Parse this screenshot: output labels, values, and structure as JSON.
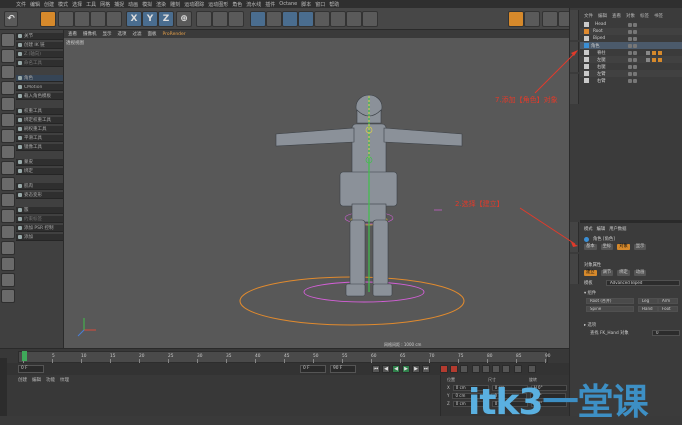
{
  "menubar": [
    "文件",
    "编辑",
    "创建",
    "模式",
    "选择",
    "工具",
    "网格",
    "捕捉",
    "动画",
    "模拟",
    "渲染",
    "雕刻",
    "运动跟踪",
    "运动图形",
    "角色",
    "流水线",
    "插件",
    "Octane",
    "脚本",
    "窗口",
    "帮助"
  ],
  "toolbar": {
    "undo_label": "↶",
    "axis_x": "X",
    "axis_y": "Y",
    "axis_z": "Z",
    "coord_label": "⊕"
  },
  "left_menu": [
    {
      "label": "关节",
      "dim": false,
      "hl": false
    },
    {
      "label": "创建 IK 链",
      "dim": false,
      "hl": false
    },
    {
      "label": "Z.(轴向)",
      "dim": true,
      "hl": false
    },
    {
      "label": "命名工具",
      "dim": true,
      "hl": false
    },
    {
      "label": "角色",
      "dim": false,
      "hl": true
    },
    {
      "label": "CMotion",
      "dim": false,
      "hl": false
    },
    {
      "label": "载入角色模板",
      "dim": false,
      "hl": false
    },
    {
      "label": "权重工具",
      "dim": false,
      "hl": false
    },
    {
      "label": "绑定权重工具",
      "dim": false,
      "hl": false
    },
    {
      "label": "刷权重工具",
      "dim": false,
      "hl": false
    },
    {
      "label": "平滑工具",
      "dim": false,
      "hl": false
    },
    {
      "label": "镜像工具",
      "dim": false,
      "hl": false
    },
    {
      "label": "蒙皮",
      "dim": false,
      "hl": false
    },
    {
      "label": "绑定",
      "dim": false,
      "hl": false
    },
    {
      "label": "肌肉",
      "dim": false,
      "hl": false
    },
    {
      "label": "姿态变形",
      "dim": false,
      "hl": false
    },
    {
      "label": "簇",
      "dim": false,
      "hl": false
    },
    {
      "label": "约束标签",
      "dim": true,
      "hl": false
    },
    {
      "label": "添加 PSR 控制",
      "dim": false,
      "hl": false
    },
    {
      "label": "添加",
      "dim": false,
      "hl": false
    }
  ],
  "viewport": {
    "menu": [
      "查看",
      "摄像机",
      "显示",
      "选项",
      "过滤",
      "面板",
      "ProRender"
    ],
    "camera_label": "透视视图",
    "grid_label": "网格间距 : 1000 cm"
  },
  "objects_panel": {
    "tabs": [
      "文件",
      "编辑",
      "查看",
      "对象",
      "标签",
      "书签"
    ],
    "rows": [
      {
        "name": "Head",
        "icon": "#c9c9c9"
      },
      {
        "name": "Root",
        "icon": "#e08a2e"
      },
      {
        "name": "Biped",
        "icon": "#c9c9c9"
      },
      {
        "name": "角色",
        "icon": "#3a8fd6"
      },
      {
        "name": "脊柱",
        "icon": "#c9c9c9"
      },
      {
        "name": "左腿",
        "icon": "#c9c9c9"
      },
      {
        "name": "右腿",
        "icon": "#c9c9c9"
      },
      {
        "name": "左臂",
        "icon": "#c9c9c9"
      },
      {
        "name": "右臂",
        "icon": "#c9c9c9"
      }
    ]
  },
  "attributes_panel": {
    "tabs": [
      "模式",
      "编辑",
      "用户数据"
    ],
    "object_label": "角色 [角色]",
    "sub_tabs": [
      "基本",
      "坐标",
      "对象",
      "显示"
    ],
    "section_label": "对象属性",
    "mode_tabs": [
      "建立",
      "调节",
      "绑定",
      "动画"
    ],
    "template_label": "模板",
    "template_value": "Advanced Biped",
    "components_label": "▾ 组件",
    "buttons": [
      "Root (合并)",
      "Spine",
      "Leg",
      "Arm",
      "Hand",
      "Foot"
    ],
    "options_label": "▸ 选项",
    "mesh_label": "查找 FK_Hand 对象",
    "mesh_value": "0"
  },
  "timeline": {
    "ticks": [
      "0",
      "5",
      "10",
      "15",
      "20",
      "25",
      "30",
      "35",
      "40",
      "45",
      "50",
      "55",
      "60",
      "65",
      "70",
      "75",
      "80",
      "85",
      "90"
    ],
    "frame_label": "0 F",
    "start_field": "0 F",
    "end_field": "90 F",
    "end2_field": "90 F"
  },
  "material_menu": [
    "创建",
    "编辑",
    "功能",
    "纹理"
  ],
  "coords": {
    "header": [
      "位置",
      "尺寸",
      "旋转"
    ],
    "rows": [
      [
        "X",
        "0 cm",
        "0 cm",
        "H 0°"
      ],
      [
        "Y",
        "0 cm",
        "0 cm",
        "P 0°"
      ],
      [
        "Z",
        "0 cm",
        "0 cm",
        "B 0°"
      ]
    ]
  },
  "annotations": {
    "a1": "7.添加【角色】对象",
    "a2": "2.选择【建立】"
  },
  "watermark": {
    "brand": "itk3",
    "suffix": "一堂课"
  },
  "colors": {
    "accent": "#d6892b",
    "annotation": "#e23a2a",
    "watermark": "#5ab0e0"
  }
}
